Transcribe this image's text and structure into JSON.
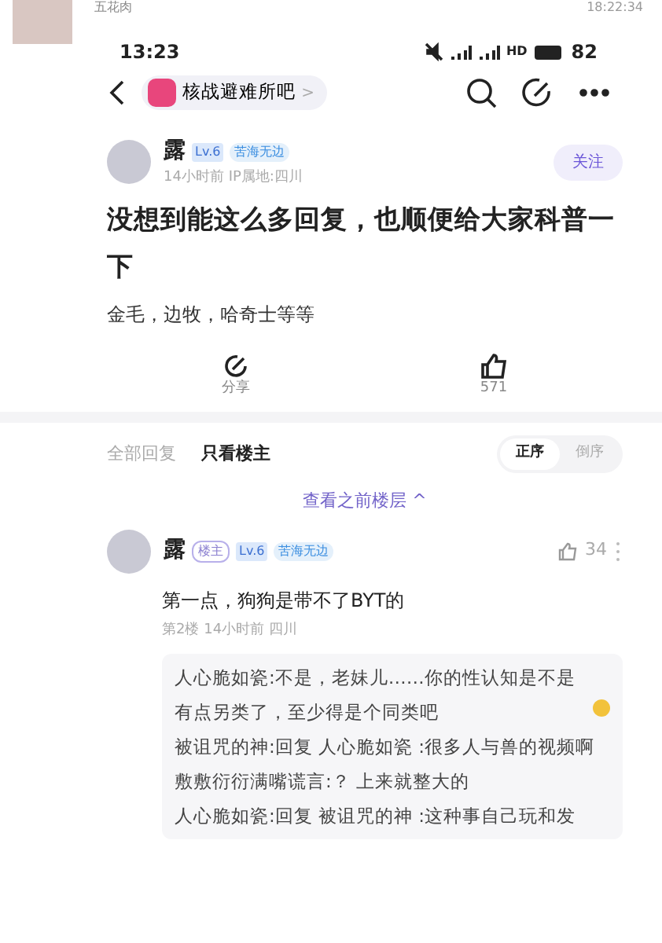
{
  "chat_message": {
    "sender": "五花肉",
    "time": "18:22:34"
  },
  "status_bar": {
    "time": "13:23",
    "battery": "82",
    "network": "HD"
  },
  "nav_bar": {
    "forum": "核战避难所吧",
    "chevron": ">"
  },
  "post": {
    "author": "露",
    "level": "Lv.6",
    "title_badge": "苦海无边",
    "meta": "14小时前  IP属地:四川",
    "follow": "关注",
    "title": "没想到能这么多回复，也顺便给大家科普一下",
    "body": "金毛，边牧，哈奇士等等",
    "share": "分享",
    "likes": "571"
  },
  "reply_tabs": [
    {
      "label": "全部回复",
      "selected": false
    },
    {
      "label": "只看楼主",
      "selected": true
    }
  ],
  "sort": [
    {
      "label": "正序",
      "selected": true
    },
    {
      "label": "倒序",
      "selected": false
    }
  ],
  "previous_floors": "查看之前楼层 ^",
  "reply": {
    "author": "露",
    "op_badge": "楼主",
    "level": "Lv.6",
    "title_badge": "苦海无边",
    "likes": "34",
    "content": "第一点，狗狗是带不了BYT的",
    "meta": "第2楼  14小时前  四川",
    "sub_replies": [
      {
        "user": "人心脆如瓷:",
        "text": "不是，老妹儿……你的性认知是不是有点另类了，至少得是个同类吧",
        "emoji": true
      },
      {
        "user": "被诅咒的神:",
        "text": "回复 人心脆如瓷 :很多人与兽的视频啊",
        "emoji": false
      },
      {
        "user": "敷敷衍衍满嘴谎言:",
        "text": "？  上来就整大的",
        "emoji": false
      },
      {
        "user": "人心脆如瓷:",
        "text": "回复 被诅咒的神 :这种事自己玩和发",
        "emoji": false
      }
    ]
  }
}
